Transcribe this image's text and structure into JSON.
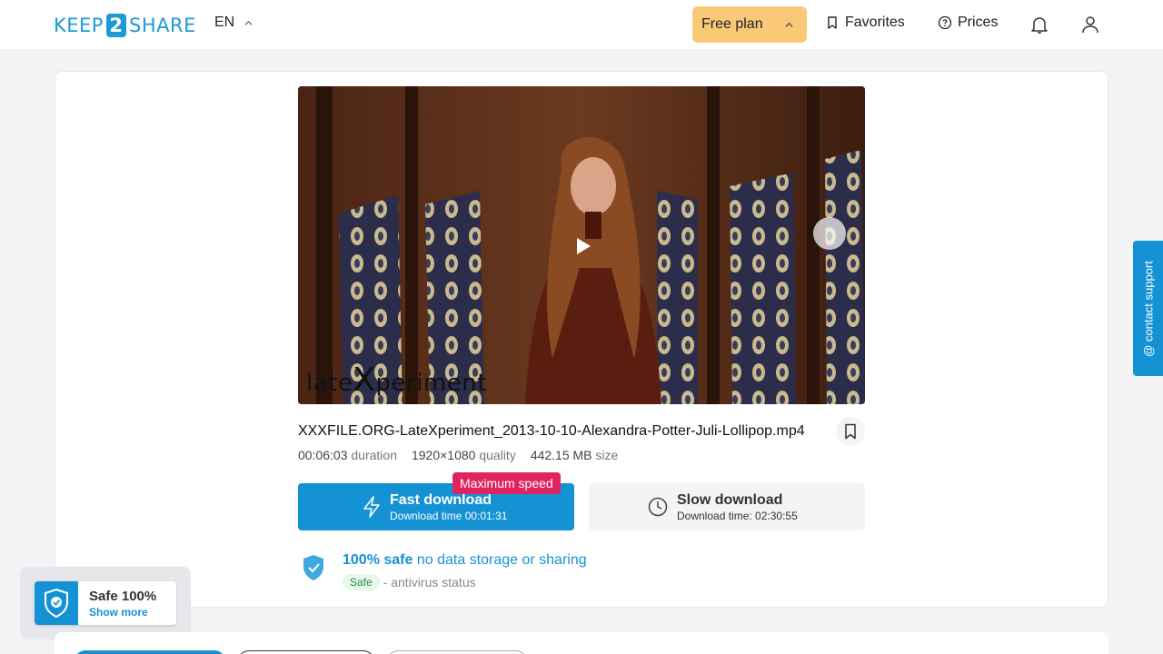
{
  "header": {
    "logo_prefix": "KEEP",
    "logo_number": "2",
    "logo_suffix": "SHARE",
    "language": "EN",
    "plan_label": "Free plan",
    "favorites_label": "Favorites",
    "prices_label": "Prices"
  },
  "video": {
    "watermark_prefix": "late",
    "watermark_big": "X",
    "watermark_suffix": "periment"
  },
  "file": {
    "name": "XXXFILE.ORG-LateXperiment_2013-10-10-Alexandra-Potter-Juli-Lollipop.mp4",
    "duration_value": "00:06:03",
    "duration_label": "duration",
    "quality_value": "1920×1080",
    "quality_label": "quality",
    "size_value": "442.15 MB",
    "size_label": "size"
  },
  "download": {
    "fast_title": "Fast download",
    "fast_time": "Download time 00:01:31",
    "badge": "Maximum speed",
    "slow_title": "Slow download",
    "slow_time": "Download time: 02:30:55"
  },
  "safety": {
    "headline_strong": "100% safe",
    "headline_rest": "no data storage or sharing",
    "status_badge": "Safe",
    "status_text": "- antivirus status"
  },
  "sidebar": {
    "contact_label": "@ contact support"
  },
  "safe_widget": {
    "title": "Safe 100%",
    "link": "Show more"
  },
  "colors": {
    "accent": "#1592d4",
    "plan_bg": "#f9c978",
    "badge": "#e0245e"
  }
}
